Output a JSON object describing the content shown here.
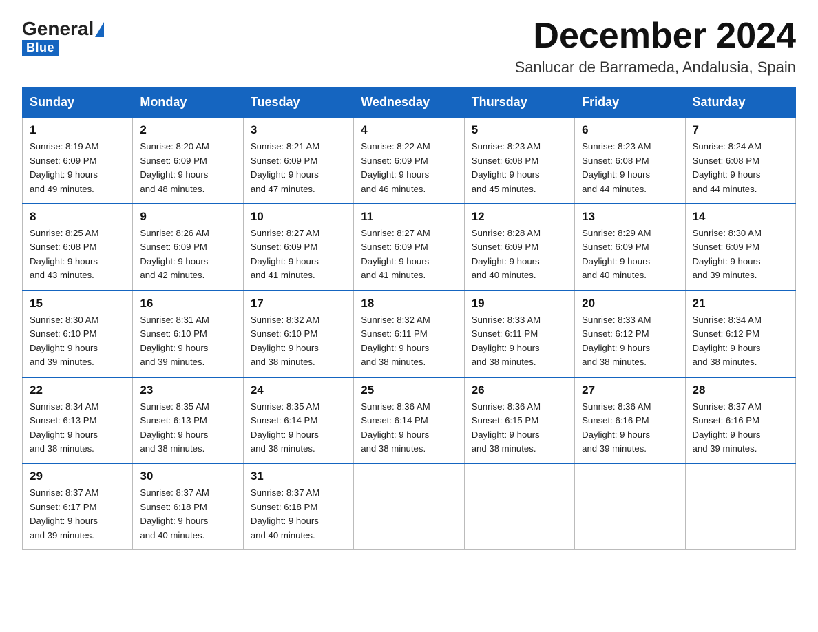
{
  "logo": {
    "text_general": "General",
    "triangle": true,
    "text_blue": "Blue"
  },
  "title": "December 2024",
  "subtitle": "Sanlucar de Barrameda, Andalusia, Spain",
  "days_of_week": [
    "Sunday",
    "Monday",
    "Tuesday",
    "Wednesday",
    "Thursday",
    "Friday",
    "Saturday"
  ],
  "weeks": [
    [
      {
        "day": "1",
        "sunrise": "Sunrise: 8:19 AM",
        "sunset": "Sunset: 6:09 PM",
        "daylight": "Daylight: 9 hours",
        "daylight2": "and 49 minutes."
      },
      {
        "day": "2",
        "sunrise": "Sunrise: 8:20 AM",
        "sunset": "Sunset: 6:09 PM",
        "daylight": "Daylight: 9 hours",
        "daylight2": "and 48 minutes."
      },
      {
        "day": "3",
        "sunrise": "Sunrise: 8:21 AM",
        "sunset": "Sunset: 6:09 PM",
        "daylight": "Daylight: 9 hours",
        "daylight2": "and 47 minutes."
      },
      {
        "day": "4",
        "sunrise": "Sunrise: 8:22 AM",
        "sunset": "Sunset: 6:09 PM",
        "daylight": "Daylight: 9 hours",
        "daylight2": "and 46 minutes."
      },
      {
        "day": "5",
        "sunrise": "Sunrise: 8:23 AM",
        "sunset": "Sunset: 6:08 PM",
        "daylight": "Daylight: 9 hours",
        "daylight2": "and 45 minutes."
      },
      {
        "day": "6",
        "sunrise": "Sunrise: 8:23 AM",
        "sunset": "Sunset: 6:08 PM",
        "daylight": "Daylight: 9 hours",
        "daylight2": "and 44 minutes."
      },
      {
        "day": "7",
        "sunrise": "Sunrise: 8:24 AM",
        "sunset": "Sunset: 6:08 PM",
        "daylight": "Daylight: 9 hours",
        "daylight2": "and 44 minutes."
      }
    ],
    [
      {
        "day": "8",
        "sunrise": "Sunrise: 8:25 AM",
        "sunset": "Sunset: 6:08 PM",
        "daylight": "Daylight: 9 hours",
        "daylight2": "and 43 minutes."
      },
      {
        "day": "9",
        "sunrise": "Sunrise: 8:26 AM",
        "sunset": "Sunset: 6:09 PM",
        "daylight": "Daylight: 9 hours",
        "daylight2": "and 42 minutes."
      },
      {
        "day": "10",
        "sunrise": "Sunrise: 8:27 AM",
        "sunset": "Sunset: 6:09 PM",
        "daylight": "Daylight: 9 hours",
        "daylight2": "and 41 minutes."
      },
      {
        "day": "11",
        "sunrise": "Sunrise: 8:27 AM",
        "sunset": "Sunset: 6:09 PM",
        "daylight": "Daylight: 9 hours",
        "daylight2": "and 41 minutes."
      },
      {
        "day": "12",
        "sunrise": "Sunrise: 8:28 AM",
        "sunset": "Sunset: 6:09 PM",
        "daylight": "Daylight: 9 hours",
        "daylight2": "and 40 minutes."
      },
      {
        "day": "13",
        "sunrise": "Sunrise: 8:29 AM",
        "sunset": "Sunset: 6:09 PM",
        "daylight": "Daylight: 9 hours",
        "daylight2": "and 40 minutes."
      },
      {
        "day": "14",
        "sunrise": "Sunrise: 8:30 AM",
        "sunset": "Sunset: 6:09 PM",
        "daylight": "Daylight: 9 hours",
        "daylight2": "and 39 minutes."
      }
    ],
    [
      {
        "day": "15",
        "sunrise": "Sunrise: 8:30 AM",
        "sunset": "Sunset: 6:10 PM",
        "daylight": "Daylight: 9 hours",
        "daylight2": "and 39 minutes."
      },
      {
        "day": "16",
        "sunrise": "Sunrise: 8:31 AM",
        "sunset": "Sunset: 6:10 PM",
        "daylight": "Daylight: 9 hours",
        "daylight2": "and 39 minutes."
      },
      {
        "day": "17",
        "sunrise": "Sunrise: 8:32 AM",
        "sunset": "Sunset: 6:10 PM",
        "daylight": "Daylight: 9 hours",
        "daylight2": "and 38 minutes."
      },
      {
        "day": "18",
        "sunrise": "Sunrise: 8:32 AM",
        "sunset": "Sunset: 6:11 PM",
        "daylight": "Daylight: 9 hours",
        "daylight2": "and 38 minutes."
      },
      {
        "day": "19",
        "sunrise": "Sunrise: 8:33 AM",
        "sunset": "Sunset: 6:11 PM",
        "daylight": "Daylight: 9 hours",
        "daylight2": "and 38 minutes."
      },
      {
        "day": "20",
        "sunrise": "Sunrise: 8:33 AM",
        "sunset": "Sunset: 6:12 PM",
        "daylight": "Daylight: 9 hours",
        "daylight2": "and 38 minutes."
      },
      {
        "day": "21",
        "sunrise": "Sunrise: 8:34 AM",
        "sunset": "Sunset: 6:12 PM",
        "daylight": "Daylight: 9 hours",
        "daylight2": "and 38 minutes."
      }
    ],
    [
      {
        "day": "22",
        "sunrise": "Sunrise: 8:34 AM",
        "sunset": "Sunset: 6:13 PM",
        "daylight": "Daylight: 9 hours",
        "daylight2": "and 38 minutes."
      },
      {
        "day": "23",
        "sunrise": "Sunrise: 8:35 AM",
        "sunset": "Sunset: 6:13 PM",
        "daylight": "Daylight: 9 hours",
        "daylight2": "and 38 minutes."
      },
      {
        "day": "24",
        "sunrise": "Sunrise: 8:35 AM",
        "sunset": "Sunset: 6:14 PM",
        "daylight": "Daylight: 9 hours",
        "daylight2": "and 38 minutes."
      },
      {
        "day": "25",
        "sunrise": "Sunrise: 8:36 AM",
        "sunset": "Sunset: 6:14 PM",
        "daylight": "Daylight: 9 hours",
        "daylight2": "and 38 minutes."
      },
      {
        "day": "26",
        "sunrise": "Sunrise: 8:36 AM",
        "sunset": "Sunset: 6:15 PM",
        "daylight": "Daylight: 9 hours",
        "daylight2": "and 38 minutes."
      },
      {
        "day": "27",
        "sunrise": "Sunrise: 8:36 AM",
        "sunset": "Sunset: 6:16 PM",
        "daylight": "Daylight: 9 hours",
        "daylight2": "and 39 minutes."
      },
      {
        "day": "28",
        "sunrise": "Sunrise: 8:37 AM",
        "sunset": "Sunset: 6:16 PM",
        "daylight": "Daylight: 9 hours",
        "daylight2": "and 39 minutes."
      }
    ],
    [
      {
        "day": "29",
        "sunrise": "Sunrise: 8:37 AM",
        "sunset": "Sunset: 6:17 PM",
        "daylight": "Daylight: 9 hours",
        "daylight2": "and 39 minutes."
      },
      {
        "day": "30",
        "sunrise": "Sunrise: 8:37 AM",
        "sunset": "Sunset: 6:18 PM",
        "daylight": "Daylight: 9 hours",
        "daylight2": "and 40 minutes."
      },
      {
        "day": "31",
        "sunrise": "Sunrise: 8:37 AM",
        "sunset": "Sunset: 6:18 PM",
        "daylight": "Daylight: 9 hours",
        "daylight2": "and 40 minutes."
      },
      null,
      null,
      null,
      null
    ]
  ]
}
